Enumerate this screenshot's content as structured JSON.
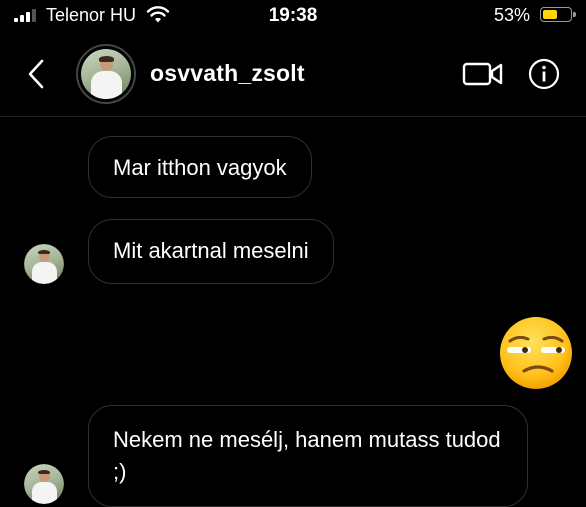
{
  "status_bar": {
    "carrier": "Telenor HU",
    "time": "19:38",
    "battery_percent": "53%",
    "battery_level": 0.53,
    "battery_color": "#ffd60a"
  },
  "header": {
    "back_icon": "chevron-left-icon",
    "username": "osvvath_zsolt",
    "video_icon": "video-camera-icon",
    "info_icon": "info-icon"
  },
  "messages": [
    {
      "text": "Mar itthon vagyok",
      "show_avatar": false
    },
    {
      "text": "Mit akartnal meselni",
      "show_avatar": true
    },
    {
      "emoji": "unamused-face",
      "sent": true
    },
    {
      "text": "Nekem ne mesélj, hanem mutass tudod ;)",
      "show_avatar": true
    }
  ],
  "colors": {
    "background": "#000000",
    "bubble_border": "#2f2f2f"
  }
}
